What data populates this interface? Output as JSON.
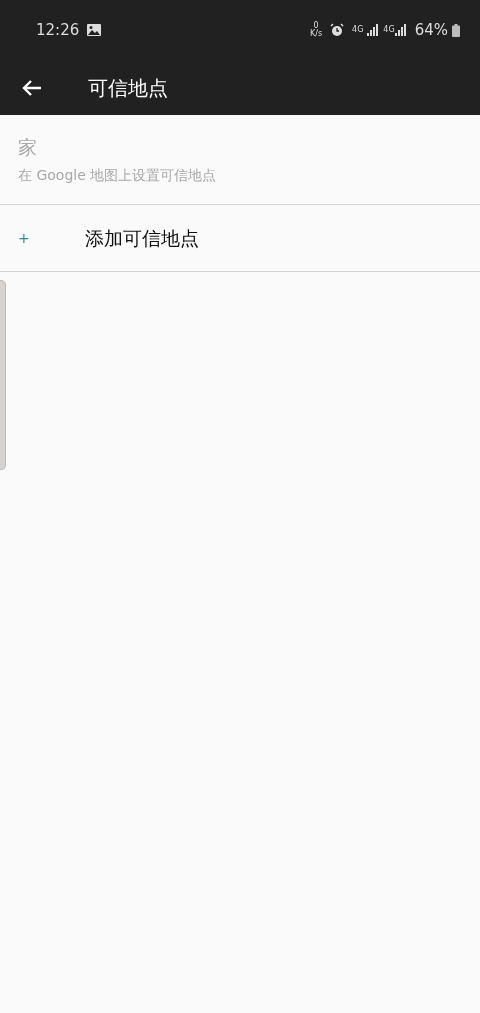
{
  "status_bar": {
    "time": "12:26",
    "net_speed_value": "0",
    "net_speed_unit": "K/s",
    "network_1": "4G",
    "network_2": "4G",
    "battery": "64%"
  },
  "app_bar": {
    "title": "可信地点"
  },
  "places": [
    {
      "kind": "place",
      "title": "家",
      "subtitle": "在 Google 地图上设置可信地点",
      "disabled": true
    },
    {
      "kind": "add",
      "icon": "+",
      "title": "添加可信地点"
    }
  ]
}
